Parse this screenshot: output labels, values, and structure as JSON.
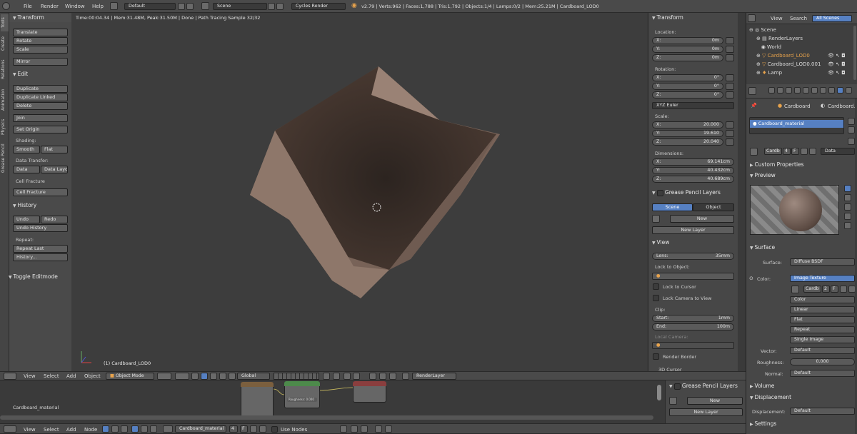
{
  "topbar": {
    "menus": [
      "File",
      "Render",
      "Window",
      "Help"
    ],
    "layout": "Default",
    "scene": "Scene",
    "engine": "Cycles Render",
    "stats": "v2.79 | Verts:962 | Faces:1,788 | Tris:1,792 | Objects:1/4 | Lamps:0/2 | Mem:25.21M | Cardboard_LOD0"
  },
  "tool_tabs": [
    "Tools",
    "Create",
    "Relations",
    "Animation",
    "Physics",
    "Grease Pencil"
  ],
  "tools": {
    "transform_header": "Transform",
    "translate": "Translate",
    "rotate": "Rotate",
    "scale": "Scale",
    "mirror": "Mirror",
    "edit_header": "Edit",
    "duplicate": "Duplicate",
    "duplicate_linked": "Duplicate Linked",
    "delete": "Delete",
    "join": "Join",
    "set_origin": "Set Origin",
    "shading_label": "Shading:",
    "smooth": "Smooth",
    "flat": "Flat",
    "data_transfer_label": "Data Transfer:",
    "data": "Data",
    "data_layout": "Data Layo",
    "cell_fracture_label": "Cell Fracture",
    "cell_fracture_btn": "Cell Fracture",
    "history_header": "History",
    "undo": "Undo",
    "redo": "Redo",
    "undo_history": "Undo History",
    "repeat_label": "Repeat:",
    "repeat_last": "Repeat Last",
    "history_btn": "History...",
    "toggle_editmode": "Toggle Editmode"
  },
  "viewport": {
    "info": "Time:00:04.34 | Mem:31.48M, Peak:31.50M | Done | Path Tracing Sample 32/32",
    "object_name": "(1) Cardboard_LOD0"
  },
  "properties": {
    "transform_header": "Transform",
    "location_label": "Location:",
    "location": [
      {
        "axis": "X:",
        "value": "0m"
      },
      {
        "axis": "Y:",
        "value": "0m"
      },
      {
        "axis": "Z:",
        "value": "0m"
      }
    ],
    "rotation_label": "Rotation:",
    "rotation": [
      {
        "axis": "X:",
        "value": "0°"
      },
      {
        "axis": "Y:",
        "value": "0°"
      },
      {
        "axis": "Z:",
        "value": "0°"
      }
    ],
    "rotation_mode": "XYZ Euler",
    "scale_label": "Scale:",
    "scale": [
      {
        "axis": "X:",
        "value": "20.000"
      },
      {
        "axis": "Y:",
        "value": "19.610"
      },
      {
        "axis": "Z:",
        "value": "20.040"
      }
    ],
    "dimensions_label": "Dimensions:",
    "dimensions": [
      {
        "axis": "X:",
        "value": "69.141cm"
      },
      {
        "axis": "Y:",
        "value": "40.432cm"
      },
      {
        "axis": "Z:",
        "value": "40.689cm"
      }
    ],
    "gp_header": "Grease Pencil Layers",
    "gp_scene": "Scene",
    "gp_object": "Object",
    "gp_new": "New",
    "gp_new_layer": "New Layer",
    "view_header": "View",
    "lens_label": "Lens:",
    "lens_value": "35mm",
    "lock_object_label": "Lock to Object:",
    "lock_cursor": "Lock to Cursor",
    "lock_camera": "Lock Camera to View",
    "clip_label": "Clip:",
    "clip_start_label": "Start:",
    "clip_start": "1mm",
    "clip_end_label": "End:",
    "clip_end": "100m",
    "local_camera": "Local Camera:",
    "render_border": "Render Border",
    "cursor_3d": "3D Cursor"
  },
  "outliner": {
    "view": "View",
    "search": "Search",
    "filter": "All Scenes",
    "items": [
      "Scene",
      "RenderLayers",
      "World",
      "Cardboard_LOD0",
      "Cardboard_LOD0.001",
      "Lamp"
    ]
  },
  "material": {
    "breadcrumb_object": "Cardboard",
    "breadcrumb_mat": "Cardboard...",
    "slot": "Cardboard_material",
    "mat_name": "Cardb",
    "users": "4",
    "fake": "F",
    "link": "Data",
    "custom_props": "Custom Properties",
    "preview": "Preview",
    "surface_header": "Surface",
    "surface_label": "Surface:",
    "surface_value": "Diffuse BSDF",
    "color_label": "Color:",
    "color_value": "Image Texture",
    "img_name": "Cardb",
    "img_users": "2",
    "img_fake": "F",
    "img_opts": [
      "Color",
      "Linear",
      "Flat",
      "Repeat",
      "Single Image"
    ],
    "vector_label": "Vector:",
    "vector_value": "Default",
    "roughness_label": "Roughness:",
    "roughness_value": "0.000",
    "normal_label": "Normal:",
    "normal_value": "Default",
    "volume": "Volume",
    "displacement_header": "Displacement",
    "displacement_label": "Displacement:",
    "displacement_value": "Default",
    "settings": "Settings"
  },
  "viewport_header": {
    "view": "View",
    "select": "Select",
    "add": "Add",
    "object": "Object",
    "mode": "Object Mode",
    "orientation": "Global",
    "render_layer": "RenderLayer"
  },
  "node_editor": {
    "material_label": "Cardboard_material",
    "gp_header": "Grease Pencil Layers",
    "gp_new": "New",
    "gp_new_layer": "New Layer",
    "roughness_slot": "Roughness: 0.000"
  },
  "node_header": {
    "view": "View",
    "select": "Select",
    "add": "Add",
    "node": "Node",
    "material": "Cardboard_material",
    "users": "4",
    "fake": "F",
    "use_nodes": "Use Nodes"
  }
}
